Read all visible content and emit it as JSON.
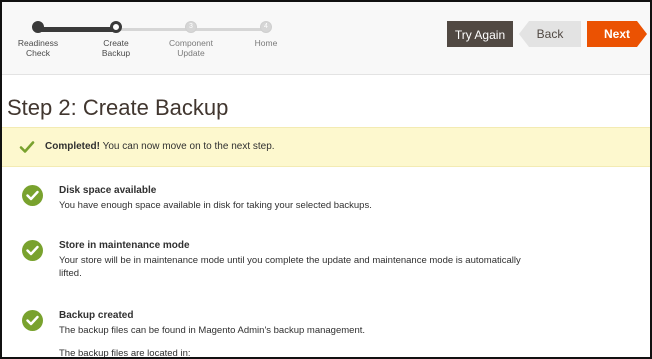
{
  "wizard": {
    "steps": [
      {
        "number": "",
        "label": "Readiness\nCheck",
        "state": "done"
      },
      {
        "number": "",
        "label": "Create\nBackup",
        "state": "current"
      },
      {
        "number": "3",
        "label": "Component\nUpdate",
        "state": "todo"
      },
      {
        "number": "4",
        "label": "Home",
        "state": "todo"
      }
    ]
  },
  "buttons": {
    "try_again": "Try Again",
    "back": "Back",
    "next": "Next"
  },
  "page": {
    "title": "Step 2: Create Backup"
  },
  "notice": {
    "strong": "Completed!",
    "text": " You can now move on to the next step."
  },
  "checks": [
    {
      "title": "Disk space available",
      "desc": "You have enough space available in disk for taking your selected backups."
    },
    {
      "title": "Store in maintenance mode",
      "desc": "Your store will be in maintenance mode until you complete the update and maintenance mode is automatically lifted."
    },
    {
      "title": "Backup created",
      "desc": "The backup files can be found in Magento Admin's backup management.",
      "desc2": "The backup files are located in:"
    }
  ],
  "colors": {
    "accent": "#eb5202",
    "success": "#79a22e",
    "notice_bg": "#fdf8ce",
    "dark_button": "#514943"
  }
}
